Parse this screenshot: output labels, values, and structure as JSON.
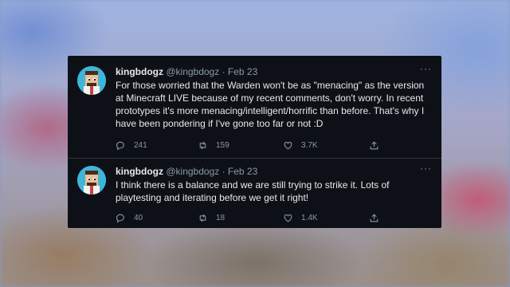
{
  "tweets": [
    {
      "name": "kingbdogz",
      "handle": "@kingbdogz",
      "date": "· Feb 23",
      "text": "For those worried that the Warden won't be as \"menacing\" as the version at Minecraft LIVE because of my recent comments, don't worry. In recent prototypes it's more menacing/intelligent/horrific than before. That's why I have been pondering if I've gone too far or not :D",
      "replies": "241",
      "retweets": "159",
      "likes": "3.7K"
    },
    {
      "name": "kingbdogz",
      "handle": "@kingbdogz",
      "date": "· Feb 23",
      "text": "I think there is a balance and we are still trying to strike it. Lots of playtesting and iterating before we get it right!",
      "replies": "40",
      "retweets": "18",
      "likes": "1.4K"
    }
  ],
  "more_label": "···",
  "colors": {
    "card_bg": "#0d1117",
    "text": "#e7e9ea",
    "muted": "#8b98a5",
    "avatar_bg": "#3fb6d8"
  }
}
